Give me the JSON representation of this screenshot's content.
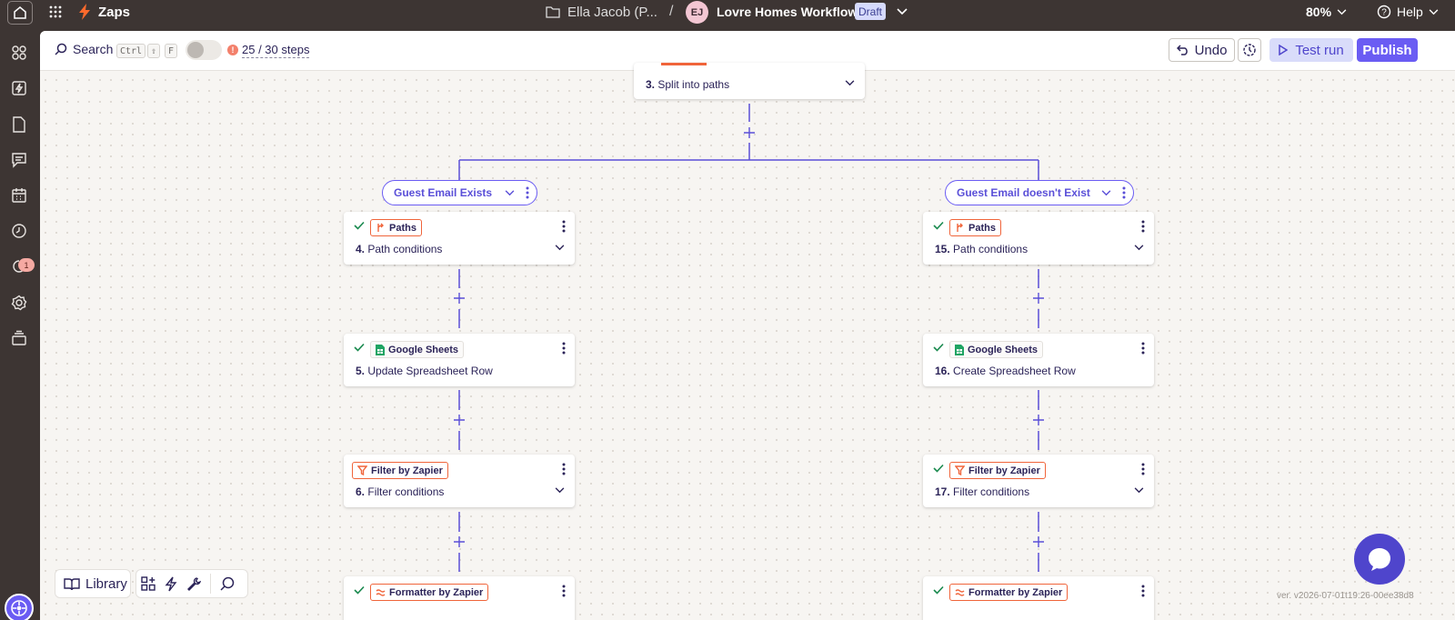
{
  "topbar": {
    "app_name": "Zaps",
    "folder_name": "Ella Jacob (P...",
    "separator": "/",
    "avatar_initials": "EJ",
    "workflow_title": "Lovre Homes Workflow",
    "status_badge": "Draft",
    "zoom": "80%",
    "help": "Help"
  },
  "toolbar": {
    "search_label": "Search",
    "shortcut_keys": [
      "Ctrl",
      "⇧",
      "F"
    ],
    "steps_progress": "25 / 30 steps",
    "undo_label": "Undo",
    "test_run_label": "Test run",
    "publish_label": "Publish"
  },
  "sidebar": {
    "items": [
      "apps-icon",
      "zaps-icon",
      "files-icon",
      "interfaces-icon",
      "tables-icon",
      "history-icon",
      "canvas-icon",
      "settings-icon",
      "layers-icon"
    ],
    "notification_count": "1"
  },
  "flow": {
    "top_step": {
      "number": "3.",
      "title": "Split into paths"
    },
    "branches": [
      {
        "label": "Guest Email Exists",
        "steps": [
          {
            "number": "4.",
            "title": "Path conditions",
            "app": "Paths",
            "checked": true
          },
          {
            "number": "5.",
            "title": "Update Spreadsheet Row",
            "app": "Google Sheets",
            "checked": true
          },
          {
            "number": "6.",
            "title": "Filter conditions",
            "app": "Filter by Zapier",
            "checked": false
          },
          {
            "number": "",
            "title": "",
            "app": "Formatter by Zapier",
            "checked": true
          }
        ]
      },
      {
        "label": "Guest Email doesn't Exist",
        "steps": [
          {
            "number": "15.",
            "title": "Path conditions",
            "app": "Paths",
            "checked": true
          },
          {
            "number": "16.",
            "title": "Create Spreadsheet Row",
            "app": "Google Sheets",
            "checked": true
          },
          {
            "number": "17.",
            "title": "Filter conditions",
            "app": "Filter by Zapier",
            "checked": true
          },
          {
            "number": "",
            "title": "",
            "app": "Formatter by Zapier",
            "checked": true
          }
        ]
      }
    ]
  },
  "dock": {
    "library_label": "Library"
  },
  "version": "ver. v2026-07-01t19:26-00ee38d8",
  "colors": {
    "accent": "#6a5cf3",
    "app_orange": "#f0643a",
    "sheets_green": "#1fa463",
    "check_green": "#1a8a4f",
    "topbar_bg": "#3d3533"
  }
}
